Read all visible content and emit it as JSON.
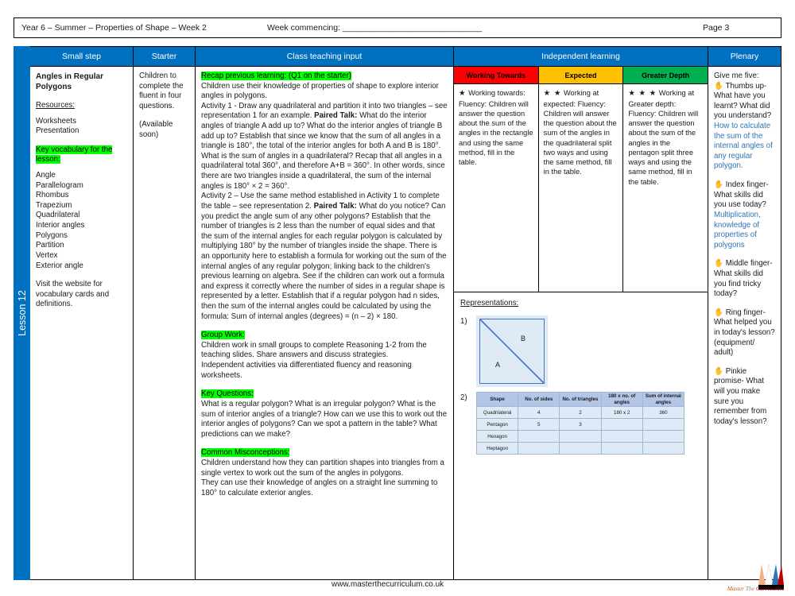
{
  "header": {
    "title": "Year 6 – Summer – Properties of Shape – Week 2",
    "week_commencing": "Week commencing: ______________________________",
    "page": "Page 3"
  },
  "spine": {
    "label": "Lesson 12"
  },
  "columns": {
    "small_step": "Small step",
    "starter": "Starter",
    "teaching": "Class teaching input",
    "independent": "Independent learning",
    "plenary": "Plenary"
  },
  "small_step": {
    "title": "Angles in Regular Polygons",
    "resources_heading": "Resources:",
    "resources": "Worksheets\nPresentation",
    "vocab_heading": "Key vocabulary for the lesson:",
    "vocab": "Angle\nParallelogram\nRhombus\nTrapezium\nQuadrilateral\nInterior angles\nPolygons\nPartition\nVertex\nExterior angle",
    "website_note": "Visit the website for vocabulary cards and definitions."
  },
  "starter": {
    "text": "Children to complete the fluent in four questions.",
    "availability": "(Available soon)"
  },
  "teaching": {
    "recap_heading": "Recap previous learning: (Q1 on the starter)",
    "recap_body": "Children use their knowledge of properties of shape to explore interior angles in polygons.",
    "activity1_pre": "Activity 1 - Draw any quadrilateral and partition it into two triangles – see representation 1 for an example. ",
    "paired_talk_label": "Paired Talk:",
    "activity1_post": " What do the interior angles of triangle A add up to? What do the interior angles of triangle B add up to? Establish that since we know that the sum of all angles in a triangle is 180°, the total of the interior angles for both A and B is 180°. What is the sum of angles in a quadrilateral? Recap that all angles in a quadrilateral total 360°, and therefore A+B = 360°. In other words, since there are two triangles inside a quadrilateral, the sum of the internal angles is 180° × 2 = 360°.",
    "activity2_pre": "Activity 2 – Use the same method established in Activity 1 to complete the table – see representation 2. ",
    "activity2_post": " What do you notice? Can you predict the angle sum of any other polygons? Establish that the number of triangles is 2 less than the number of equal sides and that the sum of the internal angles for each regular polygon is calculated by multiplying 180° by the number of triangles inside the shape. There is an opportunity here to establish a formula for working out the sum of the internal angles of any regular polygon; linking back to the children's previous learning on algebra. See if the children can work out a formula and express it correctly where the number of sides in a regular shape is represented by a letter. Establish that if a regular polygon had n sides, then the sum of the internal angles could be calculated by using the formula: Sum of internal angles (degrees) = (n – 2) × 180.",
    "group_work_heading": "Group Work:",
    "group_work_body": "Children work in small groups to complete Reasoning 1-2 from the teaching slides. Share answers and discuss strategies.\nIndependent activities via differentiated fluency and reasoning worksheets.",
    "key_questions_heading": "Key Questions:",
    "key_questions_body": "What is a regular polygon? What is an irregular polygon? What is the sum of interior angles of a triangle? How can we use this to work out the interior angles of polygons? Can we spot a pattern in the table? What predictions can we make?",
    "misconceptions_heading": "Common Misconceptions:",
    "misconceptions_body": "Children understand how they can partition shapes into triangles from a single vertex to work out the sum of the angles in polygons.\nThey can use their knowledge of angles on a straight line summing to 180° to calculate exterior angles."
  },
  "independent": {
    "levels": [
      {
        "label": "Working Towards",
        "color": "#FF0000",
        "stars": "★",
        "heading": "Working towards:",
        "body": "Fluency: Children will answer the question about the sum of the angles in the rectangle and using the same method, fill in the table."
      },
      {
        "label": "Expected",
        "color": "#FFC000",
        "stars": "★ ★",
        "heading": "Working at expected:",
        "body": "Fluency: Children will answer the question about the sum of the angles in the quadrilateral split two ways and using the same method, fill in the table."
      },
      {
        "label": "Greater Depth",
        "color": "#00B050",
        "stars": "★ ★ ★",
        "heading": "Working at Greater depth:",
        "body": "Fluency: Children will answer the question about the sum of the angles in the pentagon split three ways and using the same method, fill in the table."
      }
    ],
    "representations_heading": "Representations:",
    "rep1_num": "1)",
    "rep1_label_a": "A",
    "rep1_label_b": "B",
    "rep2_num": "2)",
    "rep2_table": {
      "headers": [
        "Shape",
        "No. of sides",
        "No. of triangles",
        "180 x no. of angles",
        "Sum of internal angles"
      ],
      "rows": [
        [
          "Quadrilateral",
          "4",
          "2",
          "180 x 2",
          "360"
        ],
        [
          "Pentagon",
          "5",
          "3",
          "",
          ""
        ],
        [
          "Hexagon",
          "",
          "",
          "",
          ""
        ],
        [
          "Heptagon",
          "",
          "",
          "",
          ""
        ]
      ]
    }
  },
  "plenary": {
    "intro": "Give me five:",
    "items": [
      {
        "icon": "hand-icon",
        "question": "Thumbs up- What have you learnt? What did you understand?",
        "answer": "How to calculate the sum of the internal angles of any regular polygon."
      },
      {
        "icon": "hand-icon",
        "question": "Index finger- What skills did you use today?",
        "answer": "Multiplication, knowledge of properties of polygons"
      },
      {
        "icon": "hand-icon",
        "question": "Middle finger- What skills did you find tricky today?",
        "answer": ""
      },
      {
        "icon": "hand-icon",
        "question": "Ring finger- What helped you in today's lesson? (equipment/ adult)",
        "answer": ""
      },
      {
        "icon": "hand-icon",
        "question": "Pinkie promise- What will you make sure you remember from today's lesson?",
        "answer": ""
      }
    ]
  },
  "footer": {
    "url": "www.masterthecurriculum.co.uk",
    "logo_word1": "Master",
    "logo_word2": "The",
    "logo_word3": "Curriculum"
  }
}
